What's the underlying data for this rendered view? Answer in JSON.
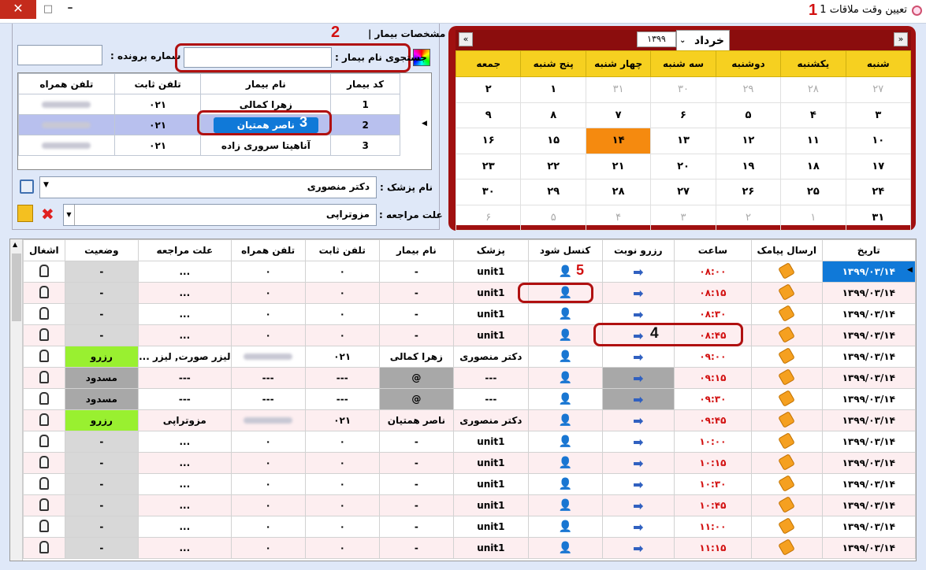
{
  "window": {
    "title": "تعیین وقت ملاقات 1",
    "close": "✕",
    "maximize": "□",
    "minimize": "–"
  },
  "annotations": [
    "1",
    "2",
    "3",
    "4",
    "5"
  ],
  "patient": {
    "section_title": "| مشخصات بیمار |",
    "file_number_label": "شماره پرونده :",
    "file_number_value": "",
    "search_label": "جستجوی نام بیمار :",
    "search_value": "",
    "columns": [
      "کد بیمار",
      "نام بیمار",
      "تلفن ثابت",
      "تلفن همراه"
    ],
    "rows": [
      {
        "code": "1",
        "name": "زهرا کمالی",
        "phone": "۰۲۱"
      },
      {
        "code": "2",
        "name": "ناصر همتیان",
        "phone": "۰۲۱"
      },
      {
        "code": "3",
        "name": "آناهیتا سروری زاده",
        "phone": "۰۲۱"
      }
    ],
    "doctor_label": "نام پزشک :",
    "doctor_value": "دکتر منصوری",
    "reason_label": "علت مراجعه :",
    "reason_value": "مزوتراپی"
  },
  "calendar": {
    "month": "خرداد",
    "year": "۱۳۹۹",
    "prev": "«",
    "next": "»",
    "weekdays": [
      "شنبه",
      "یکشنبه",
      "دوشنبه",
      "سه شنبه",
      "چهار شنبه",
      "پنج شنبه",
      "جمعه"
    ],
    "weeks": [
      [
        "۲۷",
        "۲۸",
        "۲۹",
        "۳۰",
        "۳۱",
        "۱",
        "۲"
      ],
      [
        "۳",
        "۴",
        "۵",
        "۶",
        "۷",
        "۸",
        "۹"
      ],
      [
        "۱۰",
        "۱۱",
        "۱۲",
        "۱۳",
        "۱۴",
        "۱۵",
        "۱۶"
      ],
      [
        "۱۷",
        "۱۸",
        "۱۹",
        "۲۰",
        "۲۱",
        "۲۲",
        "۲۳"
      ],
      [
        "۲۴",
        "۲۵",
        "۲۶",
        "۲۷",
        "۲۸",
        "۲۹",
        "۳۰"
      ],
      [
        "۳۱",
        "۱",
        "۲",
        "۳",
        "۴",
        "۵",
        "۶"
      ]
    ],
    "other_month": [
      [
        0,
        0
      ],
      [
        0,
        1
      ],
      [
        0,
        2
      ],
      [
        0,
        3
      ],
      [
        0,
        4
      ],
      [
        5,
        1
      ],
      [
        5,
        2
      ],
      [
        5,
        3
      ],
      [
        5,
        4
      ],
      [
        5,
        5
      ],
      [
        5,
        6
      ]
    ],
    "today": [
      2,
      4
    ]
  },
  "grid": {
    "columns": [
      "تاریخ",
      "ارسال پیامک",
      "ساعت",
      "رزرو نوبت",
      "کنسل شود",
      "پزشک",
      "نام بیمار",
      "تلفن ثابت",
      "تلفن همراه",
      "علت مراجعه",
      "وضعیت",
      "اشغال"
    ],
    "rows": [
      {
        "date": "۱۳۹۹/۰۳/۱۴",
        "time": "۰۸:۰۰",
        "doctor": "unit1",
        "name": "-",
        "phone": "۰",
        "mobile": "۰",
        "reason": "...",
        "status": "-"
      },
      {
        "date": "۱۳۹۹/۰۳/۱۴",
        "time": "۰۸:۱۵",
        "doctor": "unit1",
        "name": "-",
        "phone": "۰",
        "mobile": "۰",
        "reason": "...",
        "status": "-"
      },
      {
        "date": "۱۳۹۹/۰۳/۱۴",
        "time": "۰۸:۳۰",
        "doctor": "unit1",
        "name": "-",
        "phone": "۰",
        "mobile": "۰",
        "reason": "...",
        "status": "-"
      },
      {
        "date": "۱۳۹۹/۰۳/۱۴",
        "time": "۰۸:۴۵",
        "doctor": "unit1",
        "name": "-",
        "phone": "۰",
        "mobile": "۰",
        "reason": "...",
        "status": "-"
      },
      {
        "date": "۱۳۹۹/۰۳/۱۴",
        "time": "۰۹:۰۰",
        "doctor": "دکتر منصوری",
        "name": "زهرا کمالی",
        "phone": "۰۲۱",
        "mobile": "",
        "reason": "لیزر صورت, لیزر ...",
        "status": "رزرو"
      },
      {
        "date": "۱۳۹۹/۰۳/۱۴",
        "time": "۰۹:۱۵",
        "doctor": "---",
        "name": "@",
        "phone": "---",
        "mobile": "---",
        "reason": "---",
        "status": "مسدود"
      },
      {
        "date": "۱۳۹۹/۰۳/۱۴",
        "time": "۰۹:۳۰",
        "doctor": "---",
        "name": "@",
        "phone": "---",
        "mobile": "---",
        "reason": "---",
        "status": "مسدود"
      },
      {
        "date": "۱۳۹۹/۰۳/۱۴",
        "time": "۰۹:۴۵",
        "doctor": "دکتر منصوری",
        "name": "ناصر همتیان",
        "phone": "۰۲۱",
        "mobile": "",
        "reason": "مزوتراپی",
        "status": "رزرو"
      },
      {
        "date": "۱۳۹۹/۰۳/۱۴",
        "time": "۱۰:۰۰",
        "doctor": "unit1",
        "name": "-",
        "phone": "۰",
        "mobile": "۰",
        "reason": "...",
        "status": "-"
      },
      {
        "date": "۱۳۹۹/۰۳/۱۴",
        "time": "۱۰:۱۵",
        "doctor": "unit1",
        "name": "-",
        "phone": "۰",
        "mobile": "۰",
        "reason": "...",
        "status": "-"
      },
      {
        "date": "۱۳۹۹/۰۳/۱۴",
        "time": "۱۰:۳۰",
        "doctor": "unit1",
        "name": "-",
        "phone": "۰",
        "mobile": "۰",
        "reason": "...",
        "status": "-"
      },
      {
        "date": "۱۳۹۹/۰۳/۱۴",
        "time": "۱۰:۴۵",
        "doctor": "unit1",
        "name": "-",
        "phone": "۰",
        "mobile": "۰",
        "reason": "...",
        "status": "-"
      },
      {
        "date": "۱۳۹۹/۰۳/۱۴",
        "time": "۱۱:۰۰",
        "doctor": "unit1",
        "name": "-",
        "phone": "۰",
        "mobile": "۰",
        "reason": "...",
        "status": "-"
      },
      {
        "date": "۱۳۹۹/۰۳/۱۴",
        "time": "۱۱:۱۵",
        "doctor": "unit1",
        "name": "-",
        "phone": "۰",
        "mobile": "۰",
        "reason": "...",
        "status": "-"
      }
    ]
  },
  "colors": {
    "accent_red": "#b01010",
    "today": "#f58a0f",
    "weekday_header": "#f6d020",
    "selected": "#1079d8",
    "reserved": "#99f030",
    "blocked": "#a8a8a8"
  }
}
